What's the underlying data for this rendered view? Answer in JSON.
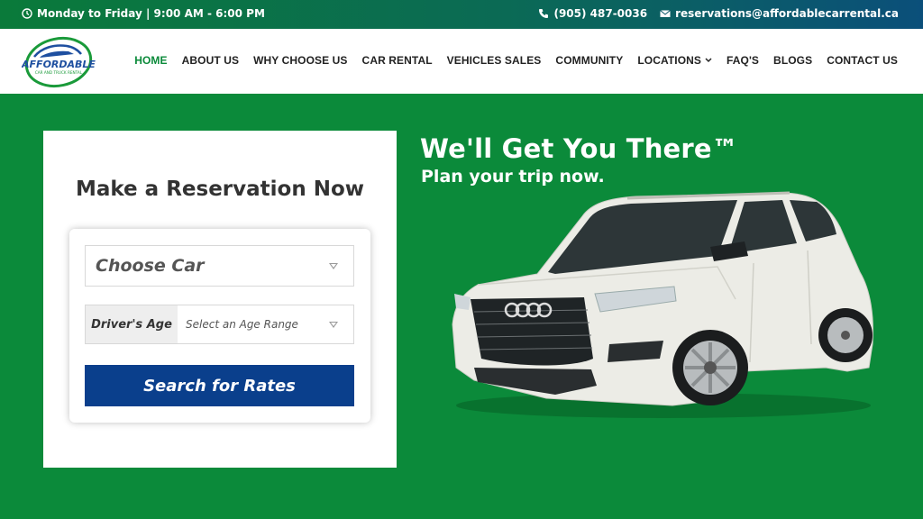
{
  "topbar": {
    "hours": "Monday to Friday | 9:00 AM - 6:00 PM",
    "phone": "(905) 487-0036",
    "email": "reservations@affordablecarrental.ca"
  },
  "logo": {
    "line1": "AFFORDABLE",
    "line2": "CAR AND TRUCK RENTAL"
  },
  "nav": {
    "items": [
      {
        "label": "HOME"
      },
      {
        "label": "ABOUT US"
      },
      {
        "label": "WHY CHOOSE US"
      },
      {
        "label": "CAR RENTAL"
      },
      {
        "label": "VEHICLES SALES"
      },
      {
        "label": "COMMUNITY"
      },
      {
        "label": "LOCATIONS"
      },
      {
        "label": "FAQ'S"
      },
      {
        "label": "BLOGS"
      },
      {
        "label": "CONTACT US"
      }
    ]
  },
  "reservation": {
    "title": "Make a Reservation Now",
    "car_select": "Choose Car",
    "age_label": "Driver's Age",
    "age_select": "Select an Age Range",
    "search_label": "Search for Rates"
  },
  "hero": {
    "headline": "We'll Get You There™",
    "subline": "Plan your trip now."
  },
  "colors": {
    "green": "#0b8a3a",
    "blue": "#0a3f8c"
  }
}
